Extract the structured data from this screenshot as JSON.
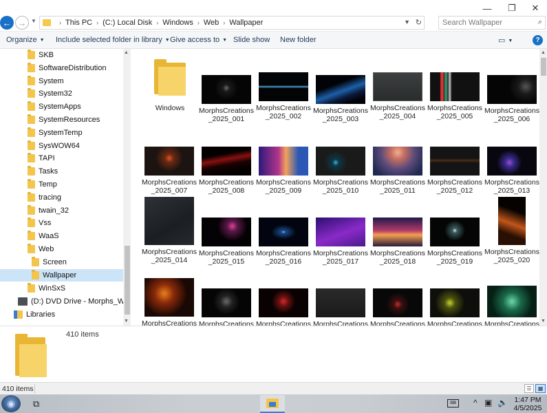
{
  "window": {
    "min_glyph": "—",
    "max_glyph": "❐",
    "close_glyph": "✕"
  },
  "address": {
    "crumbs": [
      "This PC",
      "(C:) Local Disk",
      "Windows",
      "Web",
      "Wallpaper"
    ],
    "search_placeholder": "Search Wallpaper"
  },
  "toolbar": {
    "organize": "Organize",
    "include": "Include selected folder in library",
    "give_access": "Give access to",
    "slideshow": "Slide show",
    "new_folder": "New folder",
    "help": "?"
  },
  "nav": {
    "folders": [
      "SKB",
      "SoftwareDistribution",
      "System",
      "System32",
      "SystemApps",
      "SystemResources",
      "SystemTemp",
      "SysWOW64",
      "TAPI",
      "Tasks",
      "Temp",
      "tracing",
      "twain_32",
      "Vss",
      "WaaS",
      "Web"
    ],
    "web_children": [
      "Screen",
      "Wallpaper"
    ],
    "after": "WinSxS",
    "dvd": "(D:) DVD Drive - Morphs_Win10_I",
    "libraries": "Libraries"
  },
  "items": {
    "folder": "Windows",
    "rows": [
      [
        "MorphsCreations\n_2025_001",
        "MorphsCreations\n_2025_002",
        "MorphsCreations\n_2025_003",
        "MorphsCreations\n_2025_004",
        "MorphsCreations\n_2025_005",
        "MorphsCreations\n_2025_006"
      ],
      [
        "MorphsCreations\n_2025_007",
        "MorphsCreations\n_2025_008",
        "MorphsCreations\n_2025_009",
        "MorphsCreations\n_2025_010",
        "MorphsCreations\n_2025_011",
        "MorphsCreations\n_2025_012",
        "MorphsCreations\n_2025_013"
      ],
      [
        "MorphsCreations\n_2025_014",
        "MorphsCreations\n_2025_015",
        "MorphsCreations\n_2025_016",
        "MorphsCreations\n_2025_017",
        "MorphsCreations\n_2025_018",
        "MorphsCreations\n_2025_019",
        "MorphsCreations\n_2025_020"
      ],
      [
        "MorphsCreations",
        "MorphsCreations",
        "MorphsCreations",
        "MorphsCreations",
        "MorphsCreations",
        "MorphsCreations",
        "MorphsCreations"
      ]
    ]
  },
  "details": {
    "count": "410 items"
  },
  "status": {
    "count": "410 items"
  },
  "taskbar": {
    "time": "1:47 PM",
    "date": "4/5/2025"
  },
  "colors": {
    "accent": "#1a6fc8",
    "selected": "#cce4f7",
    "folder": "#f3c54c"
  }
}
